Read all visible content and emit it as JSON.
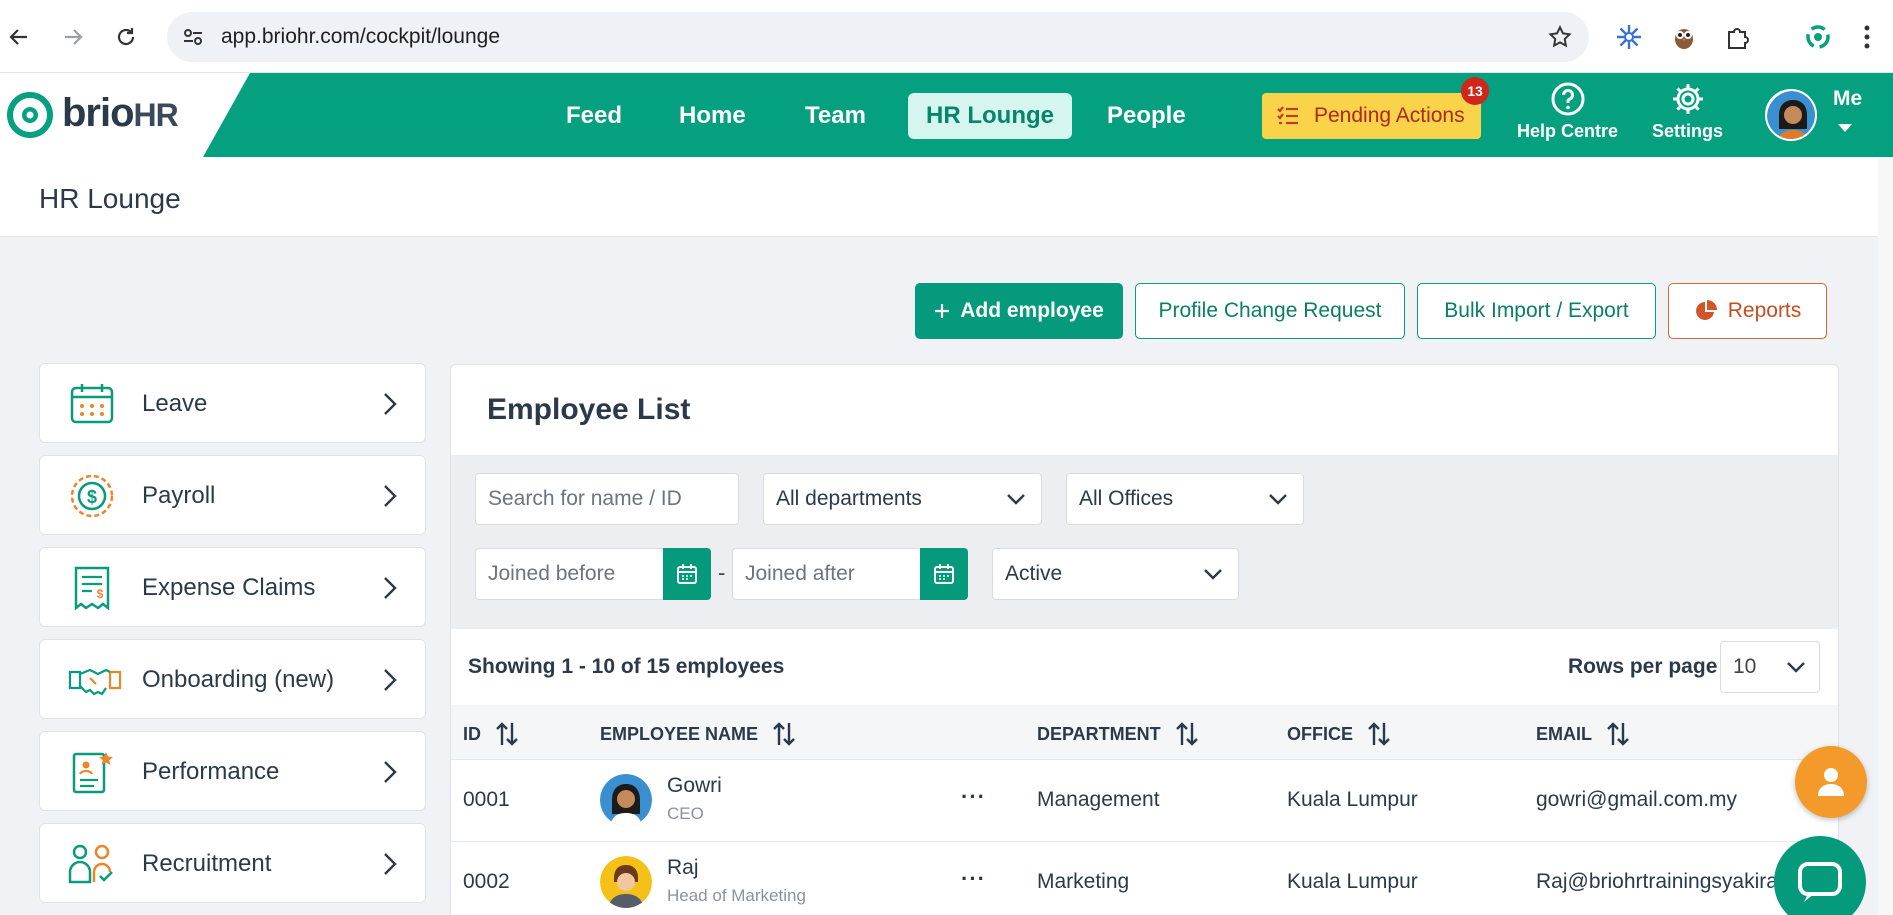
{
  "browser": {
    "url": "app.briohr.com/cockpit/lounge",
    "back_icon": "arrow-left-icon",
    "forward_icon": "arrow-right-icon",
    "reload_icon": "reload-icon",
    "bookmark_icon": "star-icon"
  },
  "header": {
    "logo_main": "brio",
    "logo_suffix": "HR",
    "nav": [
      {
        "label": "Feed"
      },
      {
        "label": "Home"
      },
      {
        "label": "Team"
      },
      {
        "label": "HR Lounge",
        "active": true
      },
      {
        "label": "People"
      }
    ],
    "pending": {
      "label": "Pending Actions",
      "count": "13"
    },
    "help_label": "Help Centre",
    "settings_label": "Settings",
    "me_label": "Me",
    "brand_color": "#04a080"
  },
  "page": {
    "title": "HR Lounge"
  },
  "actions": {
    "add_employee": "Add employee",
    "profile_change": "Profile Change Request",
    "bulk": "Bulk Import / Export",
    "reports": "Reports"
  },
  "sidebar": {
    "items": [
      {
        "label": "Leave",
        "icon": "calendar-icon"
      },
      {
        "label": "Payroll",
        "icon": "dollar-coin-icon"
      },
      {
        "label": "Expense Claims",
        "icon": "receipt-icon"
      },
      {
        "label": "Onboarding (new)",
        "icon": "handshake-icon"
      },
      {
        "label": "Performance",
        "icon": "certificate-star-icon"
      },
      {
        "label": "Recruitment",
        "icon": "people-check-icon"
      }
    ]
  },
  "employees": {
    "title": "Employee List",
    "search_placeholder": "Search for name / ID",
    "department_value": "All departments",
    "office_value": "All Offices",
    "joined_before_placeholder": "Joined before",
    "joined_after_placeholder": "Joined after",
    "dash": "-",
    "status_value": "Active",
    "showing": "Showing 1 - 10 of 15 employees",
    "rows_per_page_label": "Rows per page",
    "rows_per_page_value": "10",
    "columns": {
      "id": "ID",
      "name": "EMPLOYEE NAME",
      "department": "DEPARTMENT",
      "office": "OFFICE",
      "email": "EMAIL"
    },
    "rows": [
      {
        "id": "0001",
        "name": "Gowri",
        "role": "CEO",
        "department": "Management",
        "office": "Kuala Lumpur",
        "email": "gowri@gmail.com.my"
      },
      {
        "id": "0002",
        "name": "Raj",
        "role": "Head of Marketing",
        "department": "Marketing",
        "office": "Kuala Lumpur",
        "email": "Raj@briohrtrainingsyakira"
      }
    ],
    "more_label": "···"
  }
}
